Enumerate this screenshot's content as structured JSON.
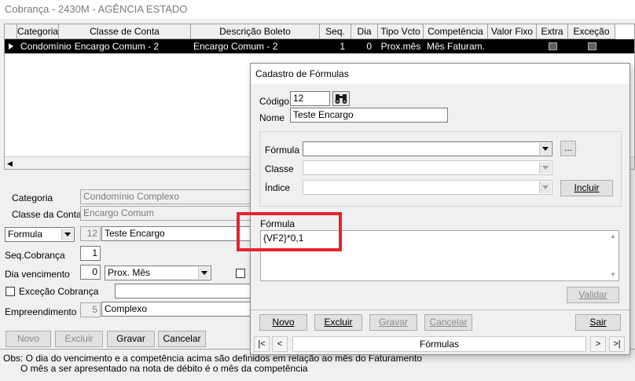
{
  "window": {
    "title": "Cobrança - 2430M - AGÊNCIA ESTADO"
  },
  "grid": {
    "columns": [
      "Categoria",
      "Classe de Conta",
      "Descrição Boleto",
      "Seq.",
      "Dia",
      "Tipo Vcto",
      "Competência",
      "Valor Fixo",
      "Extra",
      "Exceção"
    ],
    "rows": [
      {
        "categoria": "Condomínio",
        "classe": "Encargo Comum - 2",
        "descricao": "Encargo Comum - 2",
        "seq": "1",
        "dia": "0",
        "tipo": "Prox.mês",
        "competencia": "Mês Faturam.",
        "valor_fixo": ""
      }
    ]
  },
  "form": {
    "categoria_label": "Categoria",
    "categoria_value": "Condomínio Complexo",
    "classe_label": "Classe da Conta",
    "classe_value": "Encargo Comum",
    "tipo_select": "Formula",
    "formula_code": "12",
    "formula_name": "Teste Encargo",
    "seq_label": "Seq.Cobrança",
    "seq_value": "1",
    "dia_label": "Dia vencimento",
    "dia_value": "0",
    "dia_tipo": "Prox. Mês",
    "excecao_label": "Exceção Cobrança",
    "empreendimento_label": "Empreendimento",
    "empreendimento_code": "5",
    "empreendimento_name": "Complexo"
  },
  "buttons": {
    "novo": "Novo",
    "excluir": "Excluir",
    "gravar": "Gravar",
    "cancelar": "Cancelar"
  },
  "notes": {
    "line1": "Obs: O dia do vencimento e a competência acima são definidos em relação ao mês do Faturamento",
    "line2": "O mês a ser apresentado na nota de débito é o mês da competência"
  },
  "dialog": {
    "title": "Cadastro de Fórmulas",
    "codigo_label": "Código",
    "codigo_value": "12",
    "nome_label": "Nome",
    "nome_value": "Teste Encargo",
    "formula_label": "Fórmula",
    "formula_value": "",
    "ellipsis": "...",
    "classe_label": "Classe",
    "indice_label": "Índice",
    "incluir": "Incluir",
    "expr_label": "Fórmula",
    "expr_value": "{VF2}*0,1",
    "validar": "Validar",
    "buttons": {
      "novo": "Novo",
      "excluir": "Excluir",
      "gravar": "Gravar",
      "cancelar": "Cancelar",
      "sair": "Sair"
    },
    "nav": {
      "first": "|<",
      "prev": "<",
      "label": "Fórmulas",
      "next": ">",
      "last": ">|"
    }
  }
}
